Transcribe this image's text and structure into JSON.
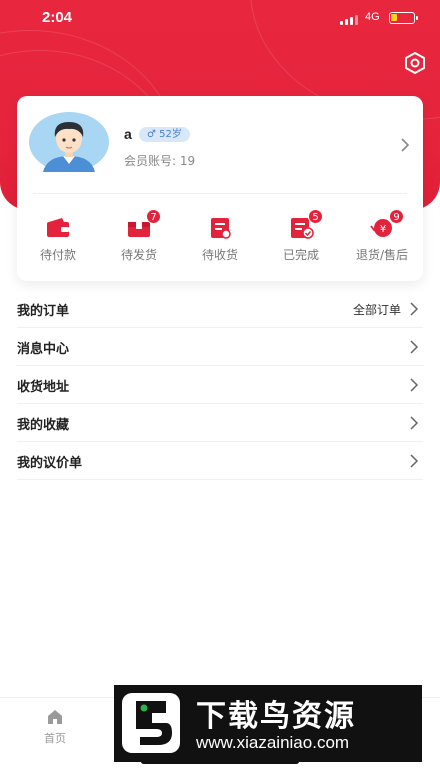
{
  "status_bar": {
    "time": "2:04",
    "network": "4G",
    "battery_level": 0.3,
    "battery_color": "#ffd21f"
  },
  "theme": {
    "accent": "#e5243c",
    "badge_bg": "#d8e7fa",
    "badge_text": "#4a7fd1"
  },
  "header": {
    "settings_icon": "settings-hexagon-icon"
  },
  "profile": {
    "name": "a",
    "gender_symbol": "♂",
    "age": "52岁",
    "member_label": "会员账号:",
    "member_id": "19",
    "avatar_icon": "user-avatar-icon"
  },
  "orders": [
    {
      "label": "待付款",
      "icon": "wallet-icon",
      "badge": ""
    },
    {
      "label": "待发货",
      "icon": "package-icon",
      "badge": "7"
    },
    {
      "label": "待收货",
      "icon": "receipt-icon",
      "badge": ""
    },
    {
      "label": "已完成",
      "icon": "completed-icon",
      "badge": "5"
    },
    {
      "label": "退货/售后",
      "icon": "refund-icon",
      "badge": "9"
    }
  ],
  "menu": {
    "my_orders": {
      "label": "我的订单",
      "extra": "全部订单"
    },
    "messages": {
      "label": "消息中心"
    },
    "address": {
      "label": "收货地址"
    },
    "favorites": {
      "label": "我的收藏"
    },
    "quotes": {
      "label": "我的议价单"
    }
  },
  "tab_bar": {
    "home_label": "首页",
    "home_icon": "home-icon"
  },
  "watermark": {
    "title": "下载鸟资源",
    "url": "www.xiazainiao.com"
  }
}
